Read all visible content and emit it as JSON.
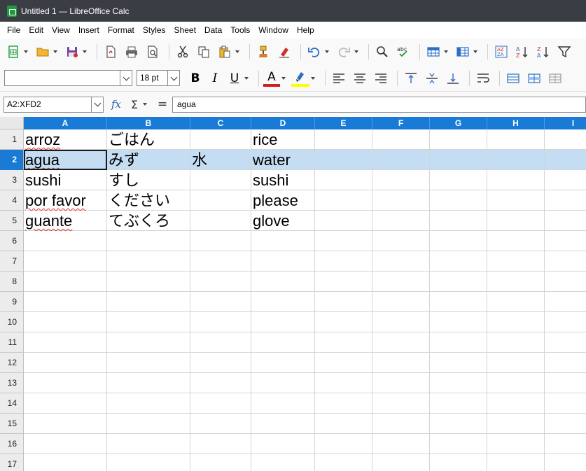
{
  "window": {
    "title": "Untitled 1 — LibreOffice Calc"
  },
  "menu": [
    "File",
    "Edit",
    "View",
    "Insert",
    "Format",
    "Styles",
    "Sheet",
    "Data",
    "Tools",
    "Window",
    "Help"
  ],
  "format_bar": {
    "font_name": "",
    "font_size": "18 pt",
    "bold_label": "B",
    "italic_label": "I",
    "underline_label": "U",
    "font_color_label": "A",
    "font_color": "#c9211e",
    "highlight_color": "#ffff00"
  },
  "formula_bar": {
    "name_box": "A2:XFD2",
    "formula": "agua"
  },
  "columns": [
    "A",
    "B",
    "C",
    "D",
    "E",
    "F",
    "G",
    "H",
    "I"
  ],
  "rows": [
    {
      "num": "1",
      "cells": [
        "arroz",
        "ごはん",
        "",
        "rice",
        "",
        "",
        "",
        "",
        ""
      ]
    },
    {
      "num": "2",
      "cells": [
        "agua",
        "みず",
        "水",
        "water",
        "",
        "",
        "",
        "",
        ""
      ]
    },
    {
      "num": "3",
      "cells": [
        "sushi",
        "すし",
        "",
        "sushi",
        "",
        "",
        "",
        "",
        ""
      ]
    },
    {
      "num": "4",
      "cells": [
        "por favor",
        "ください",
        "",
        "please",
        "",
        "",
        "",
        "",
        ""
      ]
    },
    {
      "num": "5",
      "cells": [
        "guante",
        "てぶくろ",
        "",
        "glove",
        "",
        "",
        "",
        "",
        ""
      ]
    },
    {
      "num": "6",
      "cells": [
        "",
        "",
        "",
        "",
        "",
        "",
        "",
        "",
        ""
      ]
    },
    {
      "num": "7",
      "cells": [
        "",
        "",
        "",
        "",
        "",
        "",
        "",
        "",
        ""
      ]
    },
    {
      "num": "8",
      "cells": [
        "",
        "",
        "",
        "",
        "",
        "",
        "",
        "",
        ""
      ]
    },
    {
      "num": "9",
      "cells": [
        "",
        "",
        "",
        "",
        "",
        "",
        "",
        "",
        ""
      ]
    },
    {
      "num": "10",
      "cells": [
        "",
        "",
        "",
        "",
        "",
        "",
        "",
        "",
        ""
      ]
    },
    {
      "num": "11",
      "cells": [
        "",
        "",
        "",
        "",
        "",
        "",
        "",
        "",
        ""
      ]
    },
    {
      "num": "12",
      "cells": [
        "",
        "",
        "",
        "",
        "",
        "",
        "",
        "",
        ""
      ]
    },
    {
      "num": "13",
      "cells": [
        "",
        "",
        "",
        "",
        "",
        "",
        "",
        "",
        ""
      ]
    },
    {
      "num": "14",
      "cells": [
        "",
        "",
        "",
        "",
        "",
        "",
        "",
        "",
        ""
      ]
    },
    {
      "num": "15",
      "cells": [
        "",
        "",
        "",
        "",
        "",
        "",
        "",
        "",
        ""
      ]
    },
    {
      "num": "16",
      "cells": [
        "",
        "",
        "",
        "",
        "",
        "",
        "",
        "",
        ""
      ]
    },
    {
      "num": "17",
      "cells": [
        "",
        "",
        "",
        "",
        "",
        "",
        "",
        "",
        ""
      ]
    }
  ],
  "selection": {
    "selected_row": "2",
    "active_cell": "A2"
  },
  "colors": {
    "accent": "#1a7bd7",
    "selection_fill": "#c4ddf3",
    "titlebar": "#3a3e44"
  }
}
